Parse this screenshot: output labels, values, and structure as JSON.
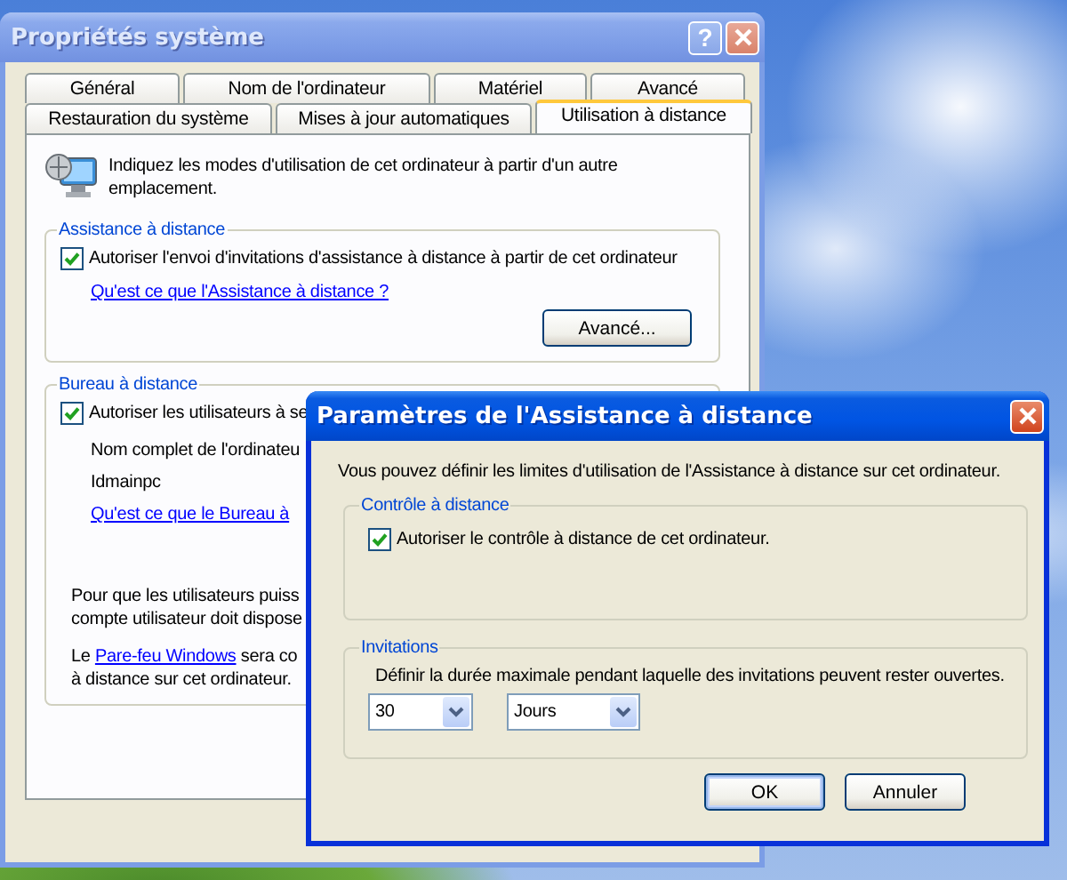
{
  "main_window": {
    "title": "Propriétés système",
    "active": false,
    "help_button": "?",
    "tab_rows": [
      [
        {
          "label": "Général",
          "selected": false
        },
        {
          "label": "Nom de l'ordinateur",
          "selected": false
        },
        {
          "label": "Matériel",
          "selected": false
        },
        {
          "label": "Avancé",
          "selected": false
        }
      ],
      [
        {
          "label": "Restauration du système",
          "selected": false
        },
        {
          "label": "Mises à jour automatiques",
          "selected": false
        },
        {
          "label": "Utilisation à distance",
          "selected": true
        }
      ]
    ],
    "intro": "Indiquez les modes d'utilisation de cet ordinateur à partir d'un autre emplacement.",
    "groups": [
      {
        "legend": "Assistance à distance",
        "items": [
          {
            "kind": "checkbox",
            "label": "Autoriser l'envoi d'invitations d'assistance à distance à partir de cet ordinateur",
            "checked": true
          },
          {
            "kind": "link",
            "text": "Qu'est ce que l'Assistance à distance ?"
          },
          {
            "kind": "button",
            "label": "Avancé..."
          }
        ]
      },
      {
        "legend": "Bureau à distance",
        "items": [
          {
            "kind": "checkbox",
            "label": "Autoriser les utilisateurs à se",
            "checked": true
          },
          {
            "kind": "text",
            "text": "Nom complet de l'ordinateu"
          },
          {
            "kind": "text",
            "text": "Idmainpc"
          },
          {
            "kind": "link",
            "text": "Qu'est ce que le Bureau à"
          },
          {
            "kind": "paragraph",
            "lines": [
              "Pour que les utilisateurs puiss",
              "compte utilisateur doit dispose"
            ]
          },
          {
            "kind": "link_paragraph",
            "before": "Le ",
            "link": "Pare-feu Windows",
            "after": " sera co",
            "line_2": "à distance sur cet ordinateur."
          }
        ]
      }
    ]
  },
  "dialog": {
    "title": "Paramètres de l'Assistance à distance",
    "active": true,
    "intro": "Vous pouvez définir les limites d'utilisation de l'Assistance à distance sur cet ordinateur.",
    "groups": [
      {
        "legend": "Contrôle à distance",
        "items": [
          {
            "kind": "checkbox",
            "label": "Autoriser le contrôle à distance de cet ordinateur.",
            "checked": true
          }
        ]
      },
      {
        "legend": "Invitations",
        "items": [
          {
            "kind": "text",
            "text": "Définir la durée maximale pendant laquelle des invitations peuvent rester ouvertes."
          },
          {
            "kind": "dropdowns",
            "values": [
              "30",
              "Jours"
            ]
          }
        ]
      }
    ],
    "buttons": [
      {
        "label": "OK",
        "default": true
      },
      {
        "label": "Annuler",
        "default": false
      }
    ]
  }
}
